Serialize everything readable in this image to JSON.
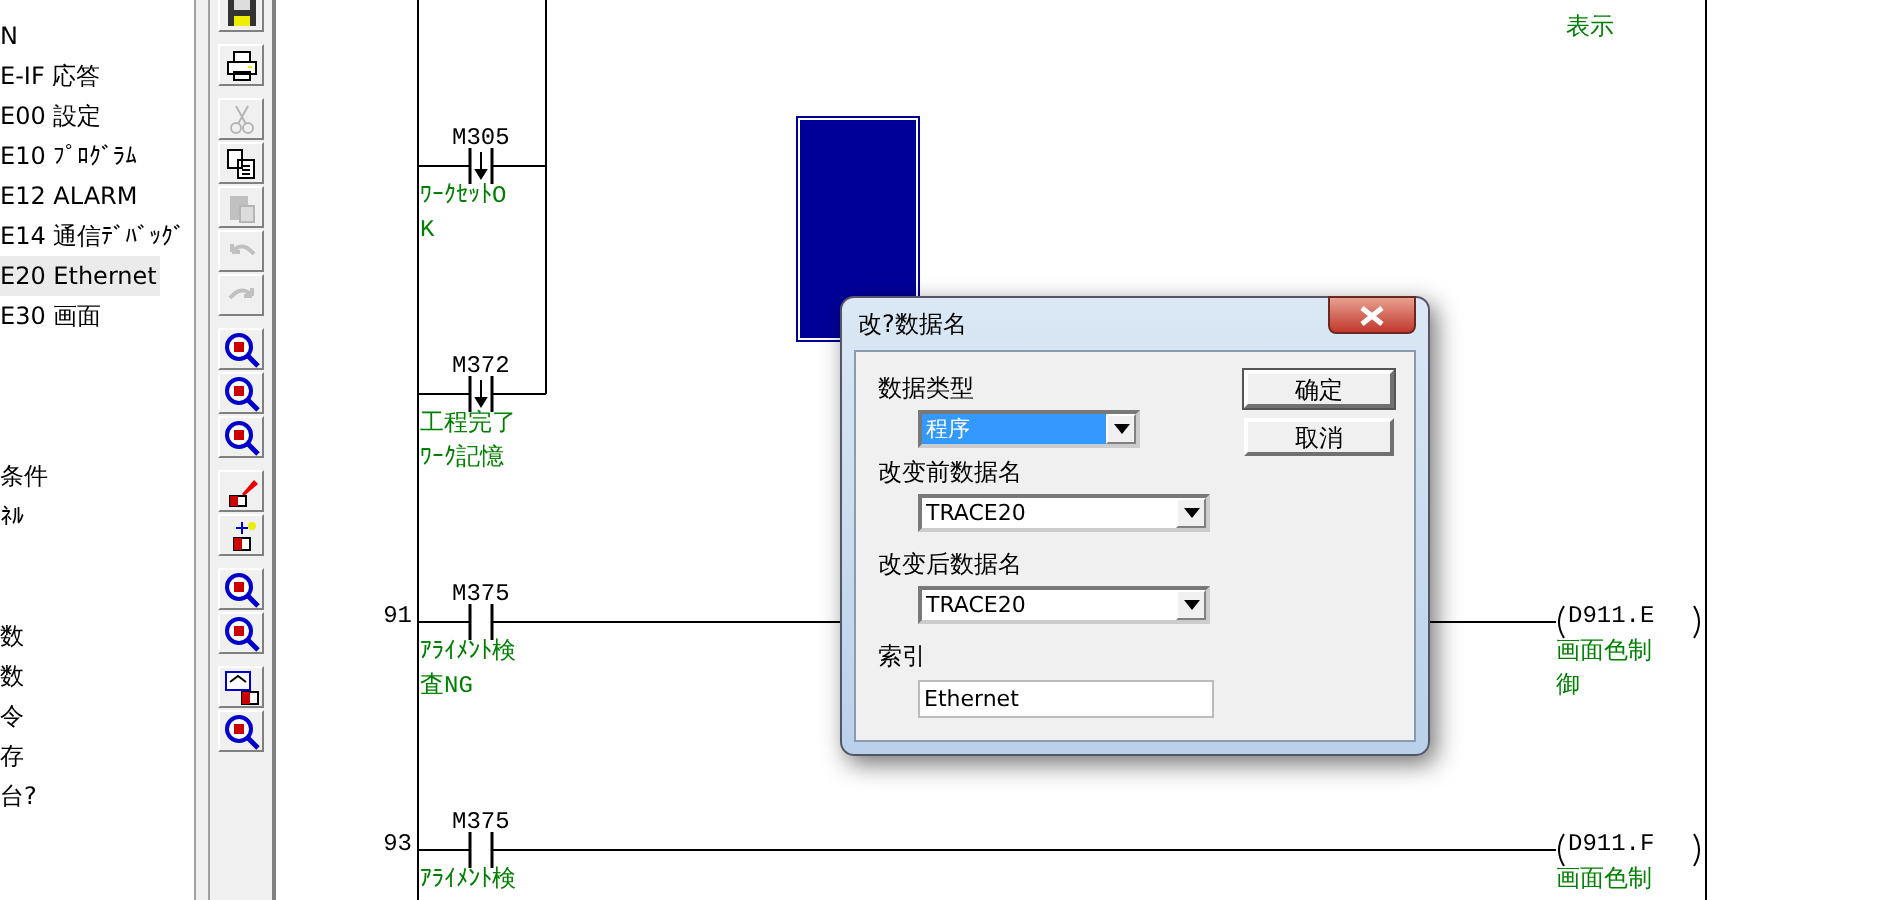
{
  "tree": {
    "items": [
      {
        "label": "N",
        "selected": false
      },
      {
        "label": "E-IF 応答",
        "selected": false
      },
      {
        "label": "E00 設定",
        "selected": false
      },
      {
        "label": "E10 ﾌﾟﾛｸﾞﾗﾑ",
        "selected": false
      },
      {
        "label": "E12 ALARM",
        "selected": false
      },
      {
        "label": "E14 通信ﾃﾞﾊﾞｯｸﾞ",
        "selected": false
      },
      {
        "label": "E20 Ethernet",
        "selected": true
      },
      {
        "label": "E30 画面",
        "selected": false
      },
      {
        "label": "条件",
        "selected": false
      },
      {
        "label": "ﾈﾙ",
        "selected": false
      },
      {
        "label": "数",
        "selected": false
      },
      {
        "label": "数",
        "selected": false
      },
      {
        "label": "令",
        "selected": false
      },
      {
        "label": "存",
        "selected": false
      },
      {
        "label": "台?",
        "selected": false
      }
    ]
  },
  "toolbar": {
    "buttons": [
      {
        "kind": "save",
        "disabled": false
      },
      {
        "kind": "print",
        "disabled": false
      },
      {
        "kind": "cut",
        "disabled": true
      },
      {
        "kind": "copy",
        "disabled": false
      },
      {
        "kind": "paste",
        "disabled": true
      },
      {
        "kind": "undo",
        "disabled": true
      },
      {
        "kind": "redo",
        "disabled": true
      },
      {
        "kind": "search",
        "disabled": false
      },
      {
        "kind": "search",
        "disabled": false
      },
      {
        "kind": "search",
        "disabled": false
      },
      {
        "kind": "edit",
        "disabled": false
      },
      {
        "kind": "insert",
        "disabled": false
      },
      {
        "kind": "search",
        "disabled": false
      },
      {
        "kind": "search",
        "disabled": false
      },
      {
        "kind": "window",
        "disabled": false
      },
      {
        "kind": "search",
        "disabled": false
      }
    ]
  },
  "ladder": {
    "top_comment": "表示",
    "branch_contacts": [
      {
        "device": "M305",
        "falling_edge": true,
        "comment": "ﾜｰｸｾｯﾄOK"
      },
      {
        "device": "M372",
        "falling_edge": true,
        "comment": "工程完了ﾜｰｸ記憶"
      }
    ],
    "rungs": [
      {
        "step": "91",
        "device": "M375",
        "falling_edge": false,
        "comment": "ｱﾗｲﾒﾝﾄ検査NG",
        "coil": "D911.E",
        "coil_comment": "画面色制御"
      },
      {
        "step": "93",
        "device": "M375",
        "falling_edge": false,
        "comment": "ｱﾗｲﾒﾝﾄ検",
        "coil": "D911.F",
        "coil_comment": "画面色制"
      }
    ]
  },
  "dialog": {
    "title": "改?数据名",
    "fields": [
      {
        "label": "数据类型",
        "kind": "dropdown",
        "value": "程序",
        "selected": true
      },
      {
        "label": "改变前数据名",
        "kind": "dropdown",
        "value": "TRACE20",
        "selected": false
      },
      {
        "label": "改变后数据名",
        "kind": "dropdown",
        "value": "TRACE20",
        "selected": false
      },
      {
        "label": "索引",
        "kind": "text",
        "value": "Ethernet",
        "selected": false
      }
    ],
    "buttons": [
      "确定",
      "取消"
    ]
  }
}
